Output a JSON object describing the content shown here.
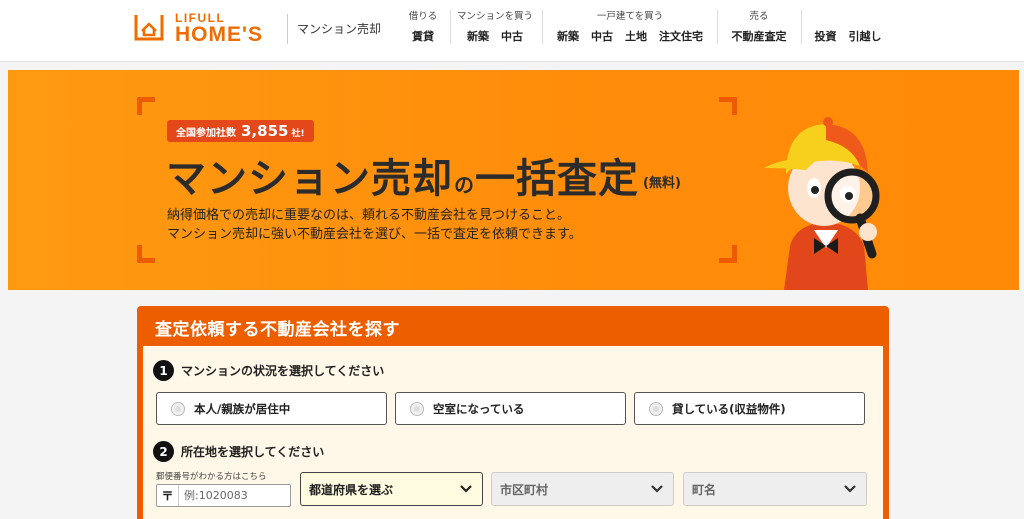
{
  "header": {
    "logo_top": "LIFULL",
    "logo_bottom": "HOME'S",
    "site_name": "マンション売却",
    "nav": [
      {
        "category": "借りる",
        "links": [
          "賃貸"
        ]
      },
      {
        "category": "マンションを買う",
        "links": [
          "新築",
          "中古"
        ]
      },
      {
        "category": "一戸建てを買う",
        "links": [
          "新築",
          "中古",
          "土地",
          "注文住宅"
        ]
      },
      {
        "category": "売る",
        "links": [
          "不動産査定"
        ]
      },
      {
        "category": "",
        "links": [
          "投資",
          "引越し"
        ]
      }
    ]
  },
  "hero": {
    "badge_label": "全国参加社数",
    "badge_count": "3,855",
    "badge_unit": "社!",
    "title_main": "マンション売却",
    "title_connector": "の",
    "title_sub": "一括査定",
    "title_free": "(無料)",
    "desc_line1": "納得価格での売却に重要なのは、頼れる不動産会社を見つけること。",
    "desc_line2": "マンション売却に強い不動産会社を選び、一括で査定を依頼できます。"
  },
  "search": {
    "title": "査定依頼する不動産会社を探す",
    "step1_num": "1",
    "step1_label": "マンションの状況を選択してください",
    "options": [
      "本人/親族が居住中",
      "空室になっている",
      "貸している(収益物件)"
    ],
    "step2_num": "2",
    "step2_label": "所在地を選択してください",
    "postal_label": "郵便番号がわかる方はこちら",
    "postal_mark": "〒",
    "postal_placeholder": "例:1020083",
    "prefecture": "都道府県を選ぶ",
    "city": "市区町村",
    "town": "町名"
  },
  "colors": {
    "brand_orange": "#ed6d00",
    "hero_orange": "#ff8c0a",
    "panel_orange": "#ec5e00",
    "badge_red": "#e4471a"
  }
}
